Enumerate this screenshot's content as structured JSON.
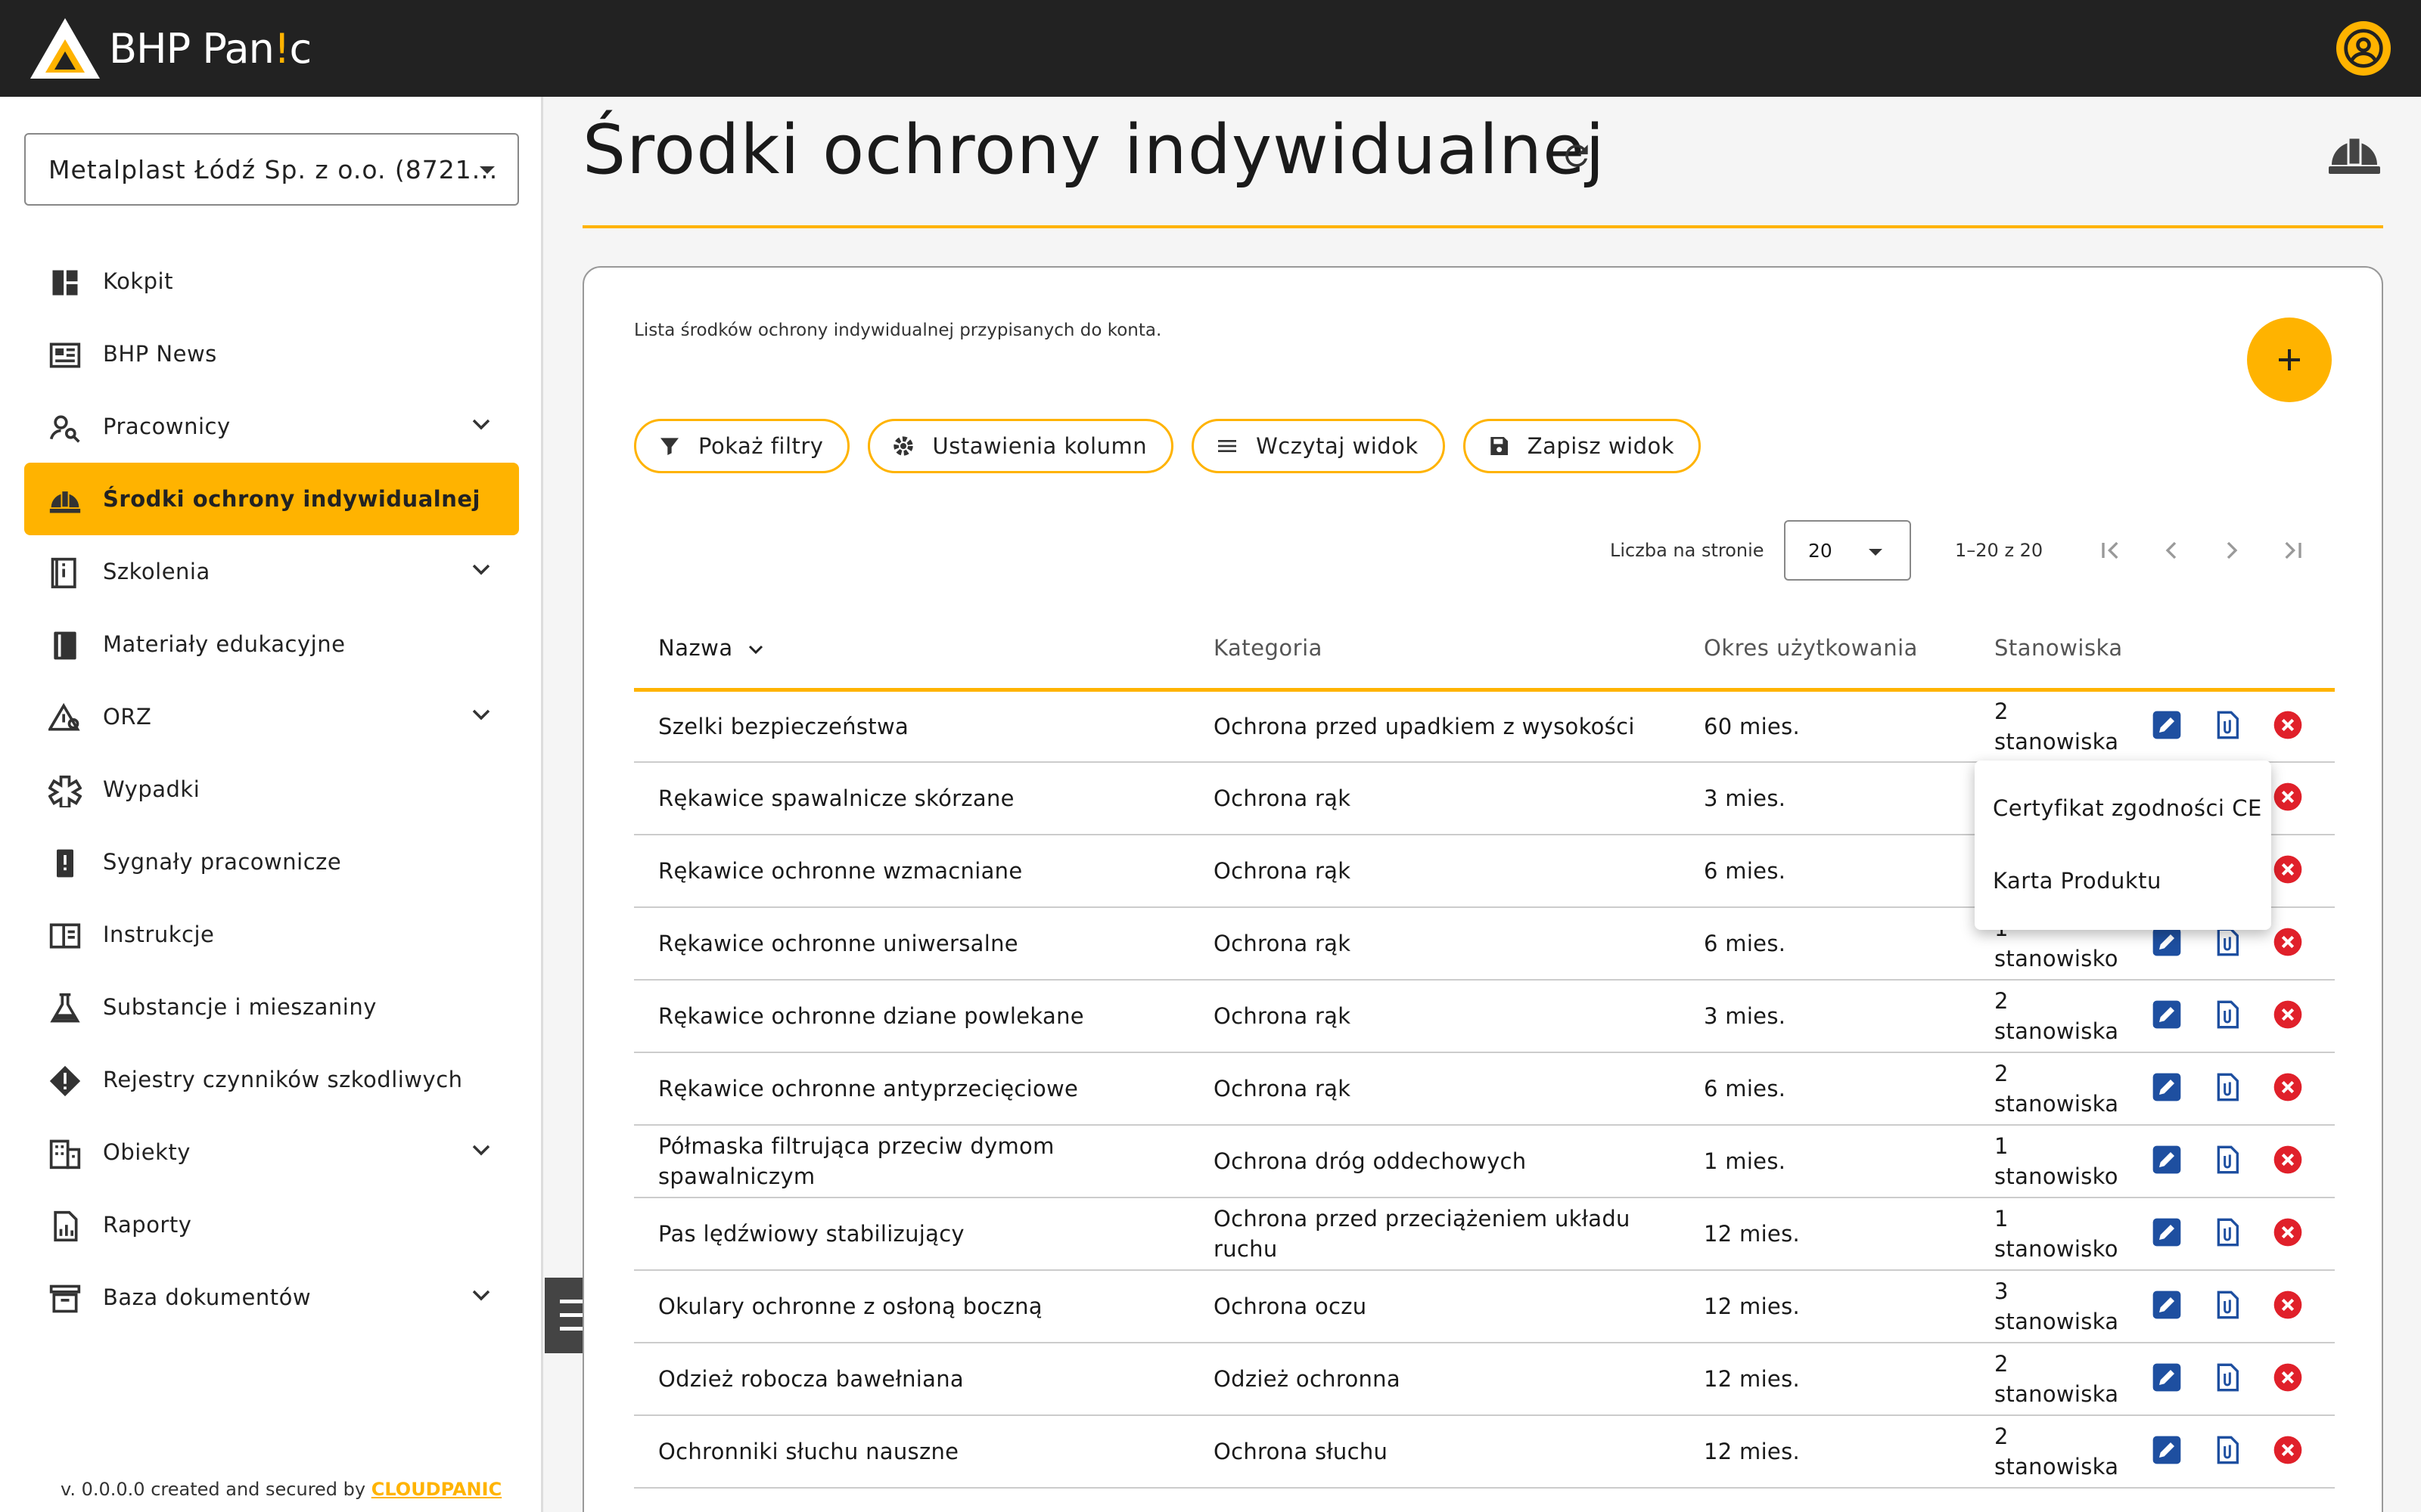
{
  "app": {
    "brand_main": "BHP Pan",
    "brand_accent": "!",
    "brand_end": "c"
  },
  "company_select": {
    "value": "Metalplast Łódź Sp. z o.o. (8721..."
  },
  "sidebar": {
    "items": [
      {
        "label": "Kokpit",
        "icon": "dashboard-icon",
        "expandable": false
      },
      {
        "label": "BHP News",
        "icon": "news-icon",
        "expandable": false
      },
      {
        "label": "Pracownicy",
        "icon": "employees-icon",
        "expandable": true
      },
      {
        "label": "Środki ochrony indywidualnej",
        "icon": "helmet-icon",
        "expandable": false,
        "active": true
      },
      {
        "label": "Szkolenia",
        "icon": "training-icon",
        "expandable": true
      },
      {
        "label": "Materiały edukacyjne",
        "icon": "book-icon",
        "expandable": false
      },
      {
        "label": "ORZ",
        "icon": "risk-icon",
        "expandable": true
      },
      {
        "label": "Wypadki",
        "icon": "medical-icon",
        "expandable": false
      },
      {
        "label": "Sygnały pracownicze",
        "icon": "alert-icon",
        "expandable": false
      },
      {
        "label": "Instrukcje",
        "icon": "instructions-icon",
        "expandable": false
      },
      {
        "label": "Substancje i mieszaniny",
        "icon": "flask-icon",
        "expandable": false
      },
      {
        "label": "Rejestry czynników szkodliwych",
        "icon": "warning-icon",
        "expandable": false
      },
      {
        "label": "Obiekty",
        "icon": "building-icon",
        "expandable": true
      },
      {
        "label": "Raporty",
        "icon": "report-icon",
        "expandable": false
      },
      {
        "label": "Baza dokumentów",
        "icon": "archive-icon",
        "expandable": true
      }
    ],
    "version_text": "v. 0.0.0.0 created and secured by ",
    "version_brand": "CLOUDPANIC"
  },
  "page": {
    "title": "Środki ochrony indywidualnej",
    "description": "Lista środków ochrony indywidualnej przypisanych do konta."
  },
  "toolbar": {
    "show_filters": "Pokaż filtry",
    "column_settings": "Ustawienia kolumn",
    "load_view": "Wczytaj widok",
    "save_view": "Zapisz widok"
  },
  "pager": {
    "per_page_label": "Liczba na stronie",
    "per_page_value": "20",
    "range": "1–20 z 20"
  },
  "table": {
    "headers": {
      "name": "Nazwa",
      "category": "Kategoria",
      "period": "Okres użytkowania",
      "positions": "Stanowiska"
    },
    "rows": [
      {
        "name": "Szelki bezpieczeństwa",
        "category": "Ochrona przed upadkiem z wysokości",
        "period": "60 mies.",
        "positions": "2 stanowiska"
      },
      {
        "name": "Rękawice spawalnicze skórzane",
        "category": "Ochrona rąk",
        "period": "3 mies.",
        "positions": ""
      },
      {
        "name": "Rękawice ochronne wzmacniane",
        "category": "Ochrona rąk",
        "period": "6 mies.",
        "positions": ""
      },
      {
        "name": "Rękawice ochronne uniwersalne",
        "category": "Ochrona rąk",
        "period": "6 mies.",
        "positions": "1 stanowisko"
      },
      {
        "name": "Rękawice ochronne dziane powlekane",
        "category": "Ochrona rąk",
        "period": "3 mies.",
        "positions": "2 stanowiska"
      },
      {
        "name": "Rękawice ochronne antyprzecięciowe",
        "category": "Ochrona rąk",
        "period": "6 mies.",
        "positions": "2 stanowiska"
      },
      {
        "name": "Półmaska filtrująca przeciw dymom spawalniczym",
        "category": "Ochrona dróg oddechowych",
        "period": "1 mies.",
        "positions": "1 stanowisko"
      },
      {
        "name": "Pas lędźwiowy stabilizujący",
        "category": "Ochrona przed przeciążeniem układu ruchu",
        "period": "12 mies.",
        "positions": "1 stanowisko"
      },
      {
        "name": "Okulary ochronne z osłoną boczną",
        "category": "Ochrona oczu",
        "period": "12 mies.",
        "positions": "3 stanowiska"
      },
      {
        "name": "Odzież robocza bawełniana",
        "category": "Odzież ochronna",
        "period": "12 mies.",
        "positions": "2 stanowiska"
      },
      {
        "name": "Ochronniki słuchu nauszne",
        "category": "Ochrona słuchu",
        "period": "12 mies.",
        "positions": "2 stanowiska"
      }
    ]
  },
  "popup_menu": {
    "items": [
      "Certyfikat zgodności CE",
      "Karta Produktu"
    ]
  },
  "colors": {
    "accent": "#ffb300",
    "topbar": "#222222",
    "edit": "#1e4fa0",
    "delete": "#e0202a"
  }
}
